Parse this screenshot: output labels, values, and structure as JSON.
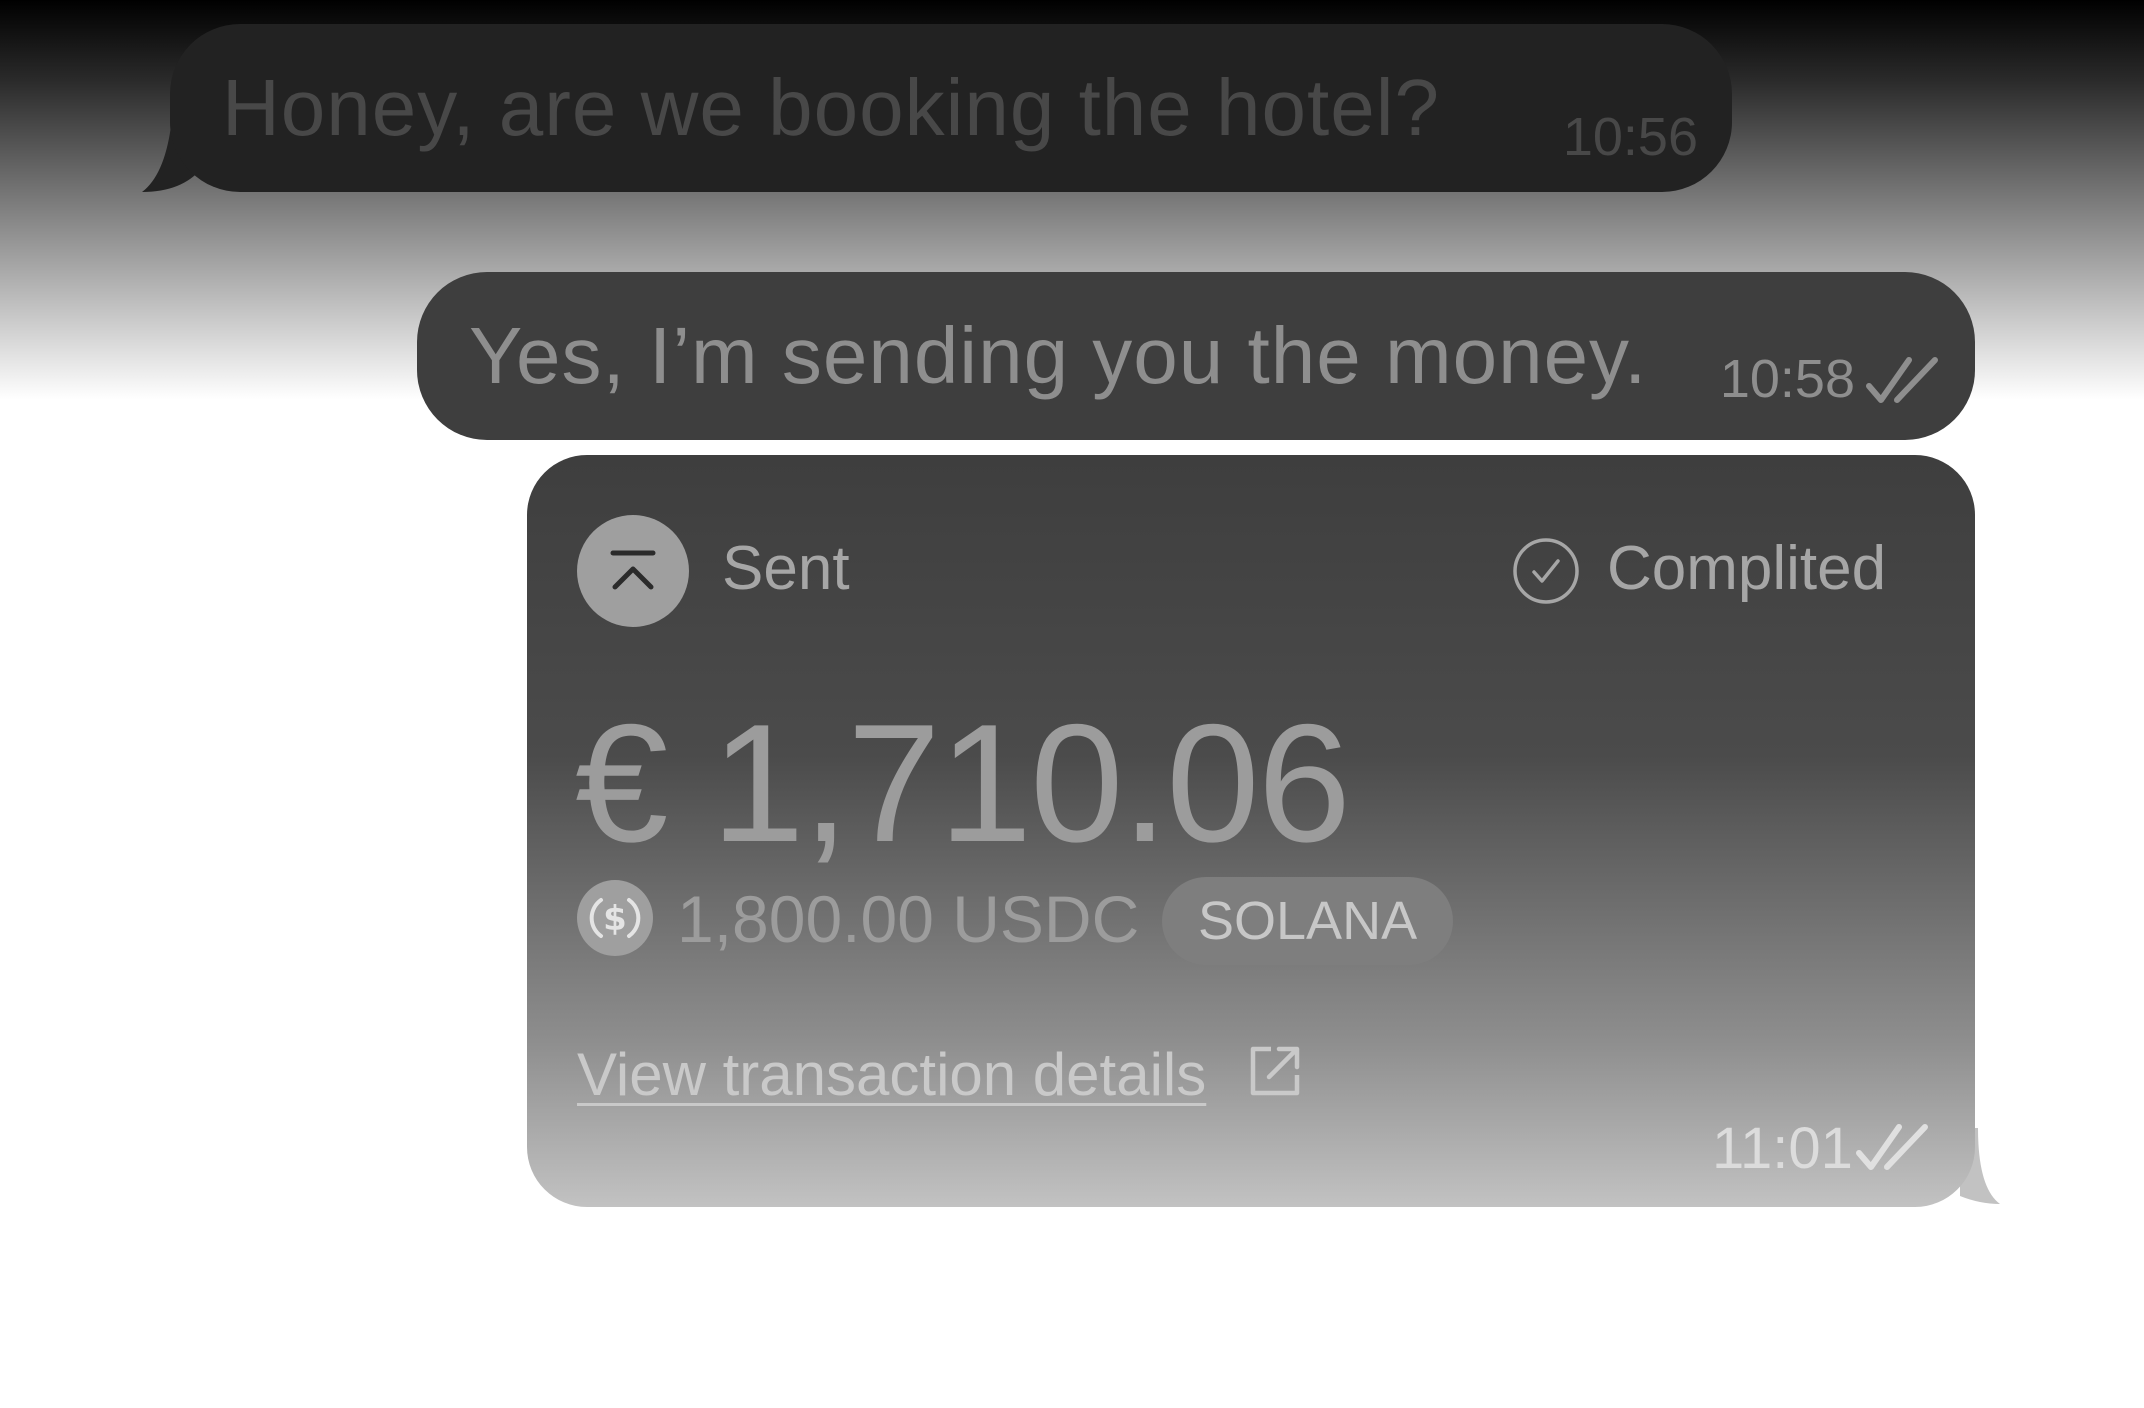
{
  "messages": [
    {
      "text": "Honey, are we booking the hotel?",
      "time": "10:56"
    },
    {
      "text": "Yes, I’m sending you the money.",
      "time": "10:58",
      "status_icon": "double-check-icon"
    }
  ],
  "transfer_card": {
    "direction_icon": "send-up-arrow-icon",
    "direction_label": "Sent",
    "status_icon": "check-circle-icon",
    "status_label": "Complited",
    "amount": "€ 1,710.06",
    "token_icon": "usdc-icon",
    "crypto_amount": "1,800.00 USDC",
    "network": "SOLANA",
    "details_link": "View transaction details",
    "link_icon": "external-link-icon",
    "time": "11:01",
    "read_icon": "double-check-icon"
  },
  "colors": {
    "incoming_bubble": "#222222",
    "outgoing_bubble": "#3e3e3e",
    "sent_icon_bg": "#9f9f9f",
    "badge_bg": "#7e7e7e"
  }
}
